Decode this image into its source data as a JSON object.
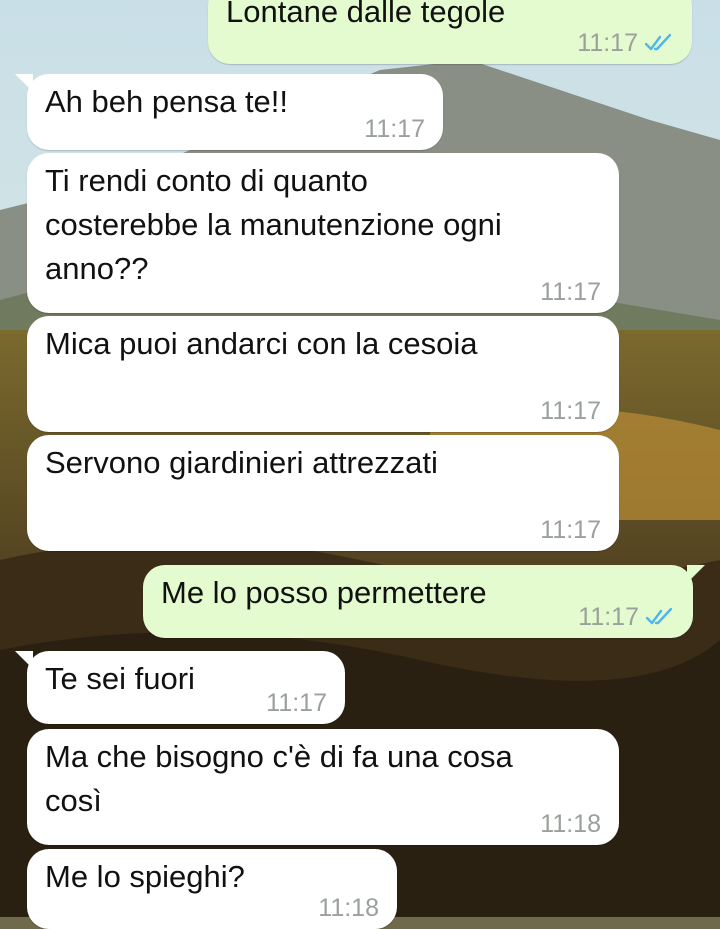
{
  "chat": {
    "messages": [
      {
        "direction": "out",
        "text": "Lontane dalle tegole",
        "time": "11:17",
        "status": "read"
      },
      {
        "direction": "in",
        "text": "Ah beh pensa te!!",
        "time": "11:17"
      },
      {
        "direction": "in",
        "text": "Ti rendi conto di quanto\ncosterebbe la manutenzione ogni\nanno??",
        "time": "11:17"
      },
      {
        "direction": "in",
        "text": "Mica puoi andarci con la cesoia",
        "time": "11:17"
      },
      {
        "direction": "in",
        "text": "Servono giardinieri attrezzati",
        "time": "11:17"
      },
      {
        "direction": "out",
        "text": "Me lo posso permettere",
        "time": "11:17",
        "status": "read"
      },
      {
        "direction": "in",
        "text": "Te sei fuori",
        "time": "11:17"
      },
      {
        "direction": "in",
        "text": "Ma che bisogno c'è di fa una cosa\ncosì",
        "time": "11:18"
      },
      {
        "direction": "in",
        "text": "Me lo spieghi?",
        "time": "11:18"
      }
    ]
  },
  "colors": {
    "incoming_bubble": "#ffffff",
    "outgoing_bubble": "#e3fbcf",
    "timestamp": "#9aa09c",
    "read_tick": "#4fb6ec"
  },
  "icons": {
    "read_receipt": "double-check-icon"
  }
}
